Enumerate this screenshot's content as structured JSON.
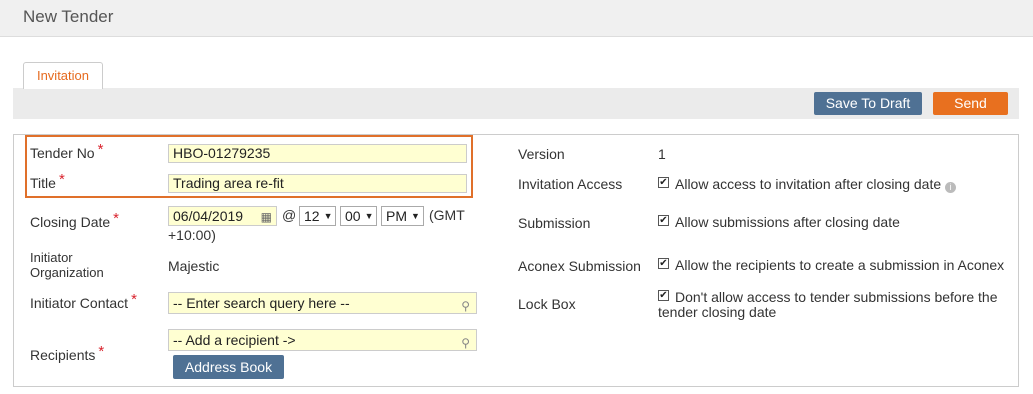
{
  "header": {
    "title": "New Tender"
  },
  "tabs": [
    {
      "label": "Invitation"
    }
  ],
  "toolbar": {
    "save_draft": "Save To Draft",
    "send": "Send"
  },
  "form": {
    "tender_no": {
      "label": "Tender No",
      "required": "*",
      "value": "HBO-01279235"
    },
    "title": {
      "label": "Title",
      "required": "*",
      "value": "Trading area re-fit"
    },
    "closing_date": {
      "label": "Closing Date",
      "required": "*",
      "date": "06/04/2019",
      "at": "@",
      "hour": "12",
      "minute": "00",
      "ampm": "PM",
      "tz_line1": "(GMT",
      "tz_line2": "+10:00)"
    },
    "initiator_org": {
      "label_line1": "Initiator",
      "label_line2": "Organization",
      "value": "Majestic"
    },
    "initiator_contact": {
      "label": "Initiator Contact",
      "required": "*",
      "placeholder": "-- Enter search query here --"
    },
    "recipients": {
      "label": "Recipients",
      "required": "*",
      "placeholder": "-- Add a recipient ->",
      "address_book": "Address Book"
    },
    "version": {
      "label": "Version",
      "value": "1"
    },
    "invitation_access": {
      "label": "Invitation Access",
      "checked": true,
      "text": "Allow access to invitation after closing date",
      "info": "i"
    },
    "submission": {
      "label": "Submission",
      "checked": true,
      "text": "Allow submissions after closing date"
    },
    "aconex_submission": {
      "label": "Aconex Submission",
      "checked": true,
      "text": "Allow the recipients to create a submission in Aconex"
    },
    "lock_box": {
      "label": "Lock Box",
      "checked": true,
      "text_line1": "Don't allow access to tender submissions before the",
      "text_line2": "tender closing date"
    }
  },
  "icons": {
    "check": "✔",
    "caret": "▼",
    "search": "⚲",
    "calendar": "▦"
  }
}
